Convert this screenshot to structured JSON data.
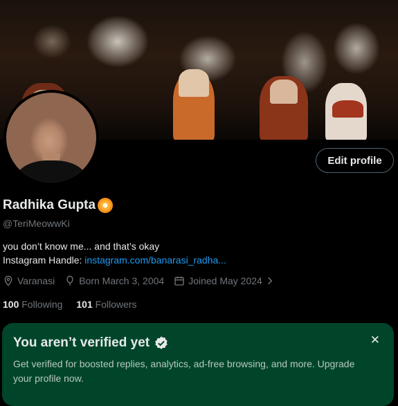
{
  "profile": {
    "edit_label": "Edit profile",
    "name": "Radhika Gupta",
    "handle": "@TeriMeowwKi",
    "bio_line1": "you don’t know me... and that’s okay",
    "bio_line2_prefix": "Instagram Handle: ",
    "bio_link": "instagram.com/banarasi_radha...",
    "location": "Varanasi",
    "born": "Born March 3, 2004",
    "joined": "Joined May 2024",
    "following_count": "100",
    "following_label": "Following",
    "followers_count": "101",
    "followers_label": "Followers"
  },
  "verify_card": {
    "title": "You aren’t verified yet",
    "body": "Get verified for boosted replies, analytics, ad-free browsing, and more. Upgrade your profile now.",
    "close_icon": "close-icon"
  },
  "icons": {
    "badge": "flower-badge-icon",
    "location": "location-pin-icon",
    "born": "balloon-icon",
    "joined": "calendar-icon",
    "chevron": "chevron-right-icon",
    "verified": "verified-check-icon"
  },
  "colors": {
    "background": "#000000",
    "link": "#1d9bf0",
    "muted": "#71767b",
    "card": "#00452a"
  }
}
